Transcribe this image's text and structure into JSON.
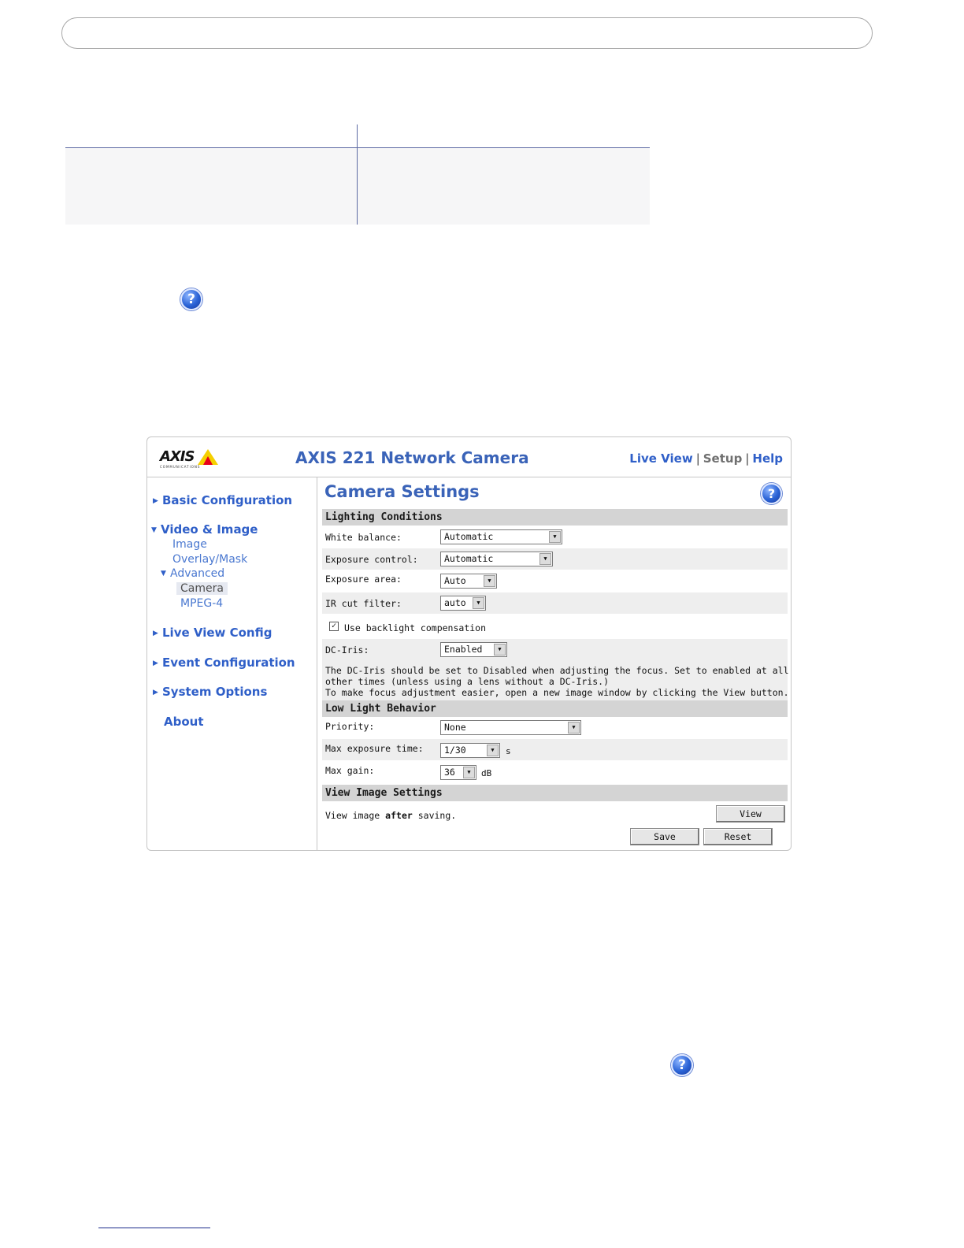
{
  "screenshot": {
    "brand": {
      "logo_text": "AXIS",
      "logo_subtext": "COMMUNICATIONS"
    },
    "title": "AXIS 221 Network Camera",
    "top_nav": {
      "live_view": "Live View",
      "setup": "Setup",
      "help": "Help",
      "separator": "|"
    },
    "sidebar": {
      "basic_configuration": "Basic Configuration",
      "video_image": "Video & Image",
      "image": "Image",
      "overlay_mask": "Overlay/Mask",
      "advanced": "Advanced",
      "camera": "Camera",
      "mpeg4": "MPEG-4",
      "live_view_config": "Live View Config",
      "event_configuration": "Event Configuration",
      "system_options": "System Options",
      "about": "About"
    },
    "page_title": "Camera Settings",
    "lighting": {
      "header": "Lighting Conditions",
      "white_balance_label": "White balance:",
      "white_balance_value": "Automatic",
      "exposure_control_label": "Exposure control:",
      "exposure_control_value": "Automatic",
      "exposure_area_label": "Exposure area:",
      "exposure_area_value": "Auto",
      "ir_cut_label": "IR cut filter:",
      "ir_cut_value": "auto",
      "backlight_label": "Use backlight compensation",
      "backlight_checked": true,
      "dc_iris_label": "DC-Iris:",
      "dc_iris_value": "Enabled",
      "note_line1": "The DC-Iris should be set to Disabled when adjusting the focus. Set to enabled at all",
      "note_line2": "other times (unless using a lens without a DC-Iris.)",
      "note_line3": "To make focus adjustment easier, open a new image window by clicking the View button."
    },
    "low_light": {
      "header": "Low Light Behavior",
      "priority_label": "Priority:",
      "priority_value": "None",
      "max_exposure_label": "Max exposure time:",
      "max_exposure_value": "1/30",
      "max_exposure_unit": "s",
      "max_gain_label": "Max gain:",
      "max_gain_value": "36",
      "max_gain_unit": "dB"
    },
    "view_image": {
      "header": "View Image Settings",
      "text_before": "View image ",
      "text_bold": "after",
      "text_after": " saving.",
      "view_button": "View"
    },
    "buttons": {
      "save": "Save",
      "reset": "Reset"
    }
  },
  "icons": {
    "help": "question-mark-icon",
    "dropdown": "▼",
    "checkmark": "✓",
    "arrow_right": "▶",
    "arrow_down": "▼"
  },
  "help_glyph": "?",
  "colors": {
    "link": "#2f5fc8",
    "title": "#3a63b8",
    "section": "#d4d4d4",
    "rule": "#5d6aa3"
  }
}
